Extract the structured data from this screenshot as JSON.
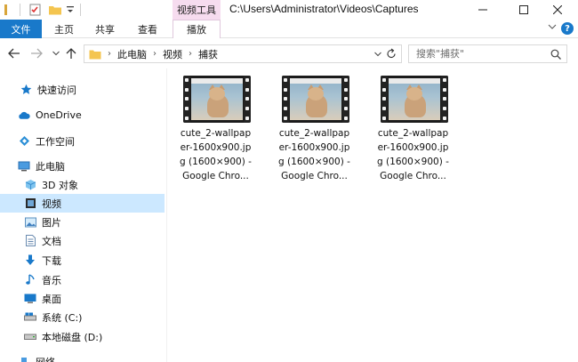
{
  "window": {
    "title_path": "C:\\Users\\Administrator\\Videos\\Captures",
    "context_tab": "视频工具"
  },
  "ribbon": {
    "tabs": [
      {
        "label": "文件",
        "active": true
      },
      {
        "label": "主页"
      },
      {
        "label": "共享"
      },
      {
        "label": "查看"
      },
      {
        "label": "播放"
      }
    ],
    "help": "?"
  },
  "address": {
    "breadcrumbs": [
      "此电脑",
      "视频",
      "捕获"
    ]
  },
  "search": {
    "placeholder": "搜索\"捕获\""
  },
  "nav": {
    "items": [
      {
        "label": "快速访问",
        "icon": "star-icon"
      },
      {
        "label": "OneDrive",
        "icon": "cloud-icon"
      },
      {
        "label": "工作空间",
        "icon": "workspace-icon"
      },
      {
        "label": "此电脑",
        "icon": "computer-icon"
      },
      {
        "label": "3D 对象",
        "icon": "cube-icon"
      },
      {
        "label": "视频",
        "icon": "video-icon",
        "selected": true
      },
      {
        "label": "图片",
        "icon": "picture-icon"
      },
      {
        "label": "文档",
        "icon": "document-icon"
      },
      {
        "label": "下载",
        "icon": "download-icon"
      },
      {
        "label": "音乐",
        "icon": "music-icon"
      },
      {
        "label": "桌面",
        "icon": "desktop-icon"
      },
      {
        "label": "系统 (C:)",
        "icon": "drive-c-icon"
      },
      {
        "label": "本地磁盘 (D:)",
        "icon": "drive-d-icon"
      },
      {
        "label": "网络",
        "icon": "network-icon"
      }
    ]
  },
  "files": [
    {
      "name_lines": [
        "cute_2-wallpap",
        "er-1600x900.jp",
        "g (1600×900) -",
        "Google Chro..."
      ]
    },
    {
      "name_lines": [
        "cute_2-wallpap",
        "er-1600x900.jp",
        "g (1600×900) -",
        "Google Chro..."
      ]
    },
    {
      "name_lines": [
        "cute_2-wallpap",
        "er-1600x900.jp",
        "g (1600×900) -",
        "Google Chro..."
      ]
    }
  ],
  "colors": {
    "accent": "#1979ca",
    "selected": "#cce8ff",
    "context_tab": "#f6dcef"
  }
}
